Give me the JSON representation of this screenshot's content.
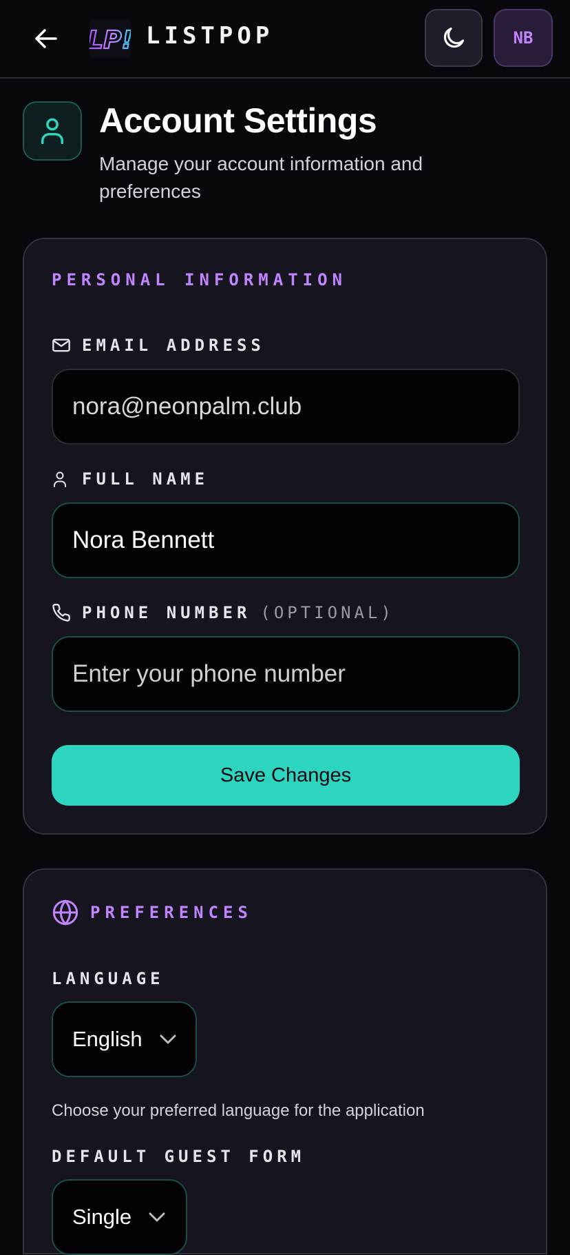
{
  "header": {
    "brand": "LISTPOP",
    "logo_text": "LP!",
    "avatar_initials": "NB"
  },
  "page": {
    "title": "Account Settings",
    "subtitle": "Manage your account information and preferences"
  },
  "personal": {
    "section_title": "PERSONAL INFORMATION",
    "email_label": "EMAIL ADDRESS",
    "email_value": "nora@neonpalm.club",
    "name_label": "FULL NAME",
    "name_value": "Nora Bennett",
    "phone_label": "PHONE NUMBER",
    "phone_optional": "(OPTIONAL)",
    "phone_value": "",
    "phone_placeholder": "Enter your phone number",
    "save_label": "Save Changes"
  },
  "preferences": {
    "section_title": "PREFERENCES",
    "language_label": "LANGUAGE",
    "language_value": "English",
    "language_help": "Choose your preferred language for the application",
    "guest_form_label": "DEFAULT GUEST FORM",
    "guest_form_value": "Single"
  },
  "colors": {
    "accent_teal": "#2dd4bf",
    "accent_purple": "#c084fc",
    "background": "#07070c",
    "card": "#15141f"
  },
  "icons": {
    "back": "arrow-left-icon",
    "theme": "moon-icon",
    "page": "user-icon",
    "email": "mail-icon",
    "name": "user-icon",
    "phone": "phone-icon",
    "preferences": "globe-icon",
    "select": "chevron-down-icon"
  }
}
